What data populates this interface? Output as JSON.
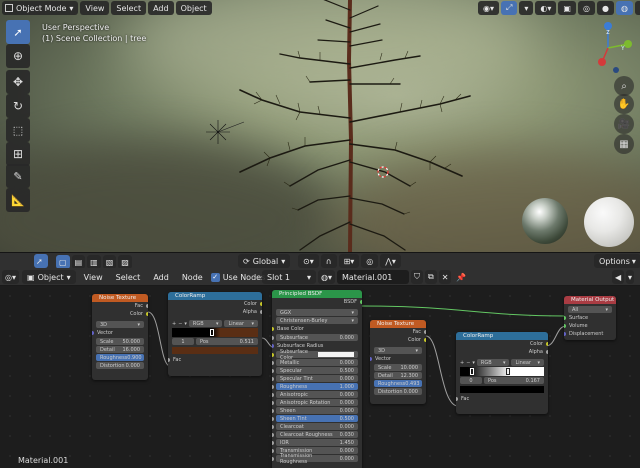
{
  "viewport": {
    "header": {
      "mode": "Object Mode",
      "menus": [
        "View",
        "Select",
        "Add",
        "Object"
      ]
    },
    "info": {
      "line1": "User Perspective",
      "line2": "(1) Scene Collection | tree"
    },
    "gizmo_axes": {
      "z": "Z",
      "y": "Y",
      "x": "X"
    }
  },
  "node_editor": {
    "header": {
      "object_label": "Object",
      "menus": [
        "View",
        "Select",
        "Add",
        "Node"
      ],
      "use_nodes": "Use Nodes",
      "slot": "Slot 1",
      "material": "Material.001"
    },
    "view_controls": {
      "global": "Global",
      "options": "Options"
    },
    "footer_label": "Material.001"
  },
  "nodes": {
    "noise1": {
      "title": "Noise Texture",
      "out_fac": "Fac",
      "out_color": "Color",
      "dim": "3D",
      "in_vector": "Vector",
      "fields": [
        {
          "label": "Scale",
          "value": "50.000"
        },
        {
          "label": "Detail",
          "value": "16.000"
        },
        {
          "label": "Roughness",
          "value": "0.900"
        },
        {
          "label": "Distortion",
          "value": "0.000"
        }
      ]
    },
    "ramp1": {
      "title": "ColorRamp",
      "out_color": "Color",
      "out_alpha": "Alpha",
      "mode": "RGB",
      "interp": "Linear",
      "stop": "1",
      "pos_label": "Pos",
      "pos": "0.511",
      "in_fac": "Fac"
    },
    "bsdf": {
      "title": "Principled BSDF",
      "out": "BSDF",
      "dist": "GGX",
      "sss_method": "Christensen-Burley",
      "inputs": [
        {
          "label": "Base Color",
          "value": "",
          "kind": "color"
        },
        {
          "label": "Subsurface",
          "value": "0.000",
          "kind": "num"
        },
        {
          "label": "Subsurface Radius",
          "value": "",
          "kind": "vec"
        },
        {
          "label": "Subsurface Color",
          "value": "",
          "kind": "swatch"
        },
        {
          "label": "Metallic",
          "value": "0.000",
          "kind": "num"
        },
        {
          "label": "Specular",
          "value": "0.500",
          "kind": "num"
        },
        {
          "label": "Specular Tint",
          "value": "0.000",
          "kind": "num"
        },
        {
          "label": "Roughness",
          "value": "1.000",
          "kind": "blue"
        },
        {
          "label": "Anisotropic",
          "value": "0.000",
          "kind": "num"
        },
        {
          "label": "Anisotropic Rotation",
          "value": "0.000",
          "kind": "num"
        },
        {
          "label": "Sheen",
          "value": "0.000",
          "kind": "num"
        },
        {
          "label": "Sheen Tint",
          "value": "0.500",
          "kind": "blue"
        },
        {
          "label": "Clearcoat",
          "value": "0.000",
          "kind": "num"
        },
        {
          "label": "Clearcoat Roughness",
          "value": "0.030",
          "kind": "num"
        },
        {
          "label": "IOR",
          "value": "1.450",
          "kind": "num"
        },
        {
          "label": "Transmission",
          "value": "0.000",
          "kind": "num"
        },
        {
          "label": "Transmission Roughness",
          "value": "0.000",
          "kind": "num"
        }
      ]
    },
    "noise2": {
      "title": "Noise Texture",
      "out_fac": "Fac",
      "out_color": "Color",
      "dim": "3D",
      "in_vector": "Vector",
      "fields": [
        {
          "label": "Scale",
          "value": "10.000"
        },
        {
          "label": "Detail",
          "value": "12.300"
        },
        {
          "label": "Roughness",
          "value": "0.493"
        },
        {
          "label": "Distortion",
          "value": "0.000"
        }
      ]
    },
    "ramp2": {
      "title": "ColorRamp",
      "out_color": "Color",
      "out_alpha": "Alpha",
      "mode": "RGB",
      "interp": "Linear",
      "stop": "0",
      "pos_label": "Pos",
      "pos": "0.167",
      "in_fac": "Fac"
    },
    "output": {
      "title": "Material Output",
      "target": "All",
      "inputs": [
        "Surface",
        "Volume",
        "Displacement"
      ]
    }
  },
  "colors": {
    "accent": "#4772b3",
    "header": "#303030",
    "node_bg": "#303030",
    "texture_header": "#c05a22",
    "shader_header": "#2b9549",
    "converter_header": "#2d6e9a",
    "output_header": "#a93c43"
  }
}
